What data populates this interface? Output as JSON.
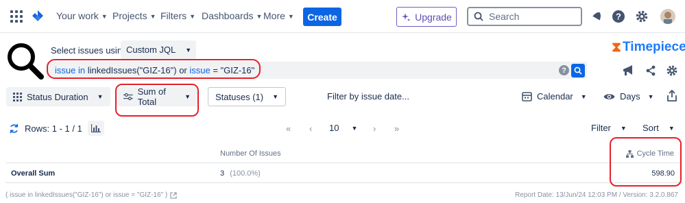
{
  "nav": {
    "items": [
      "Your work",
      "Projects",
      "Filters",
      "Dashboards",
      "More"
    ],
    "create_label": "Create",
    "upgrade_label": "Upgrade",
    "search_placeholder": "Search"
  },
  "filter": {
    "select_label": "Select issues using",
    "mode": "Custom JQL",
    "jql": {
      "kw1": "issue",
      "op1": " in ",
      "rest1": "linkedIssues(\"GIZ-16\") or ",
      "kw2": "issue",
      "rest2": " = \"GIZ-16\""
    },
    "help_label": "?"
  },
  "brand": {
    "name": "Timepiece"
  },
  "toolbar": {
    "status_duration": "Status Duration",
    "sum_of_total": "Sum of Total",
    "statuses": "Statuses (1)",
    "filter_by_date": "Filter by issue date...",
    "calendar": "Calendar",
    "days": "Days"
  },
  "pager": {
    "rows_text": "Rows: 1 - 1 / 1",
    "first": "«",
    "prev": "‹",
    "page_size": "10",
    "next": "›",
    "last": "»",
    "filter_label": "Filter",
    "sort_label": "Sort"
  },
  "table": {
    "columns": [
      "Number Of Issues",
      "Cycle Time"
    ],
    "rows": [
      {
        "label": "Overall Sum",
        "count": "3",
        "percent": "(100.0%)",
        "cycle_time": "598.90"
      }
    ]
  },
  "footer": {
    "query": "( issue in linkedIssues(\"GIZ-16\") or issue = \"GIZ-16\" )",
    "report": "Report Date: 13/Jun/24 12:03 PM / Version: 3.2.0.867"
  },
  "colors": {
    "accent": "#0c66e4",
    "highlight": "#e5202a",
    "upgrade": "#6e5dc6",
    "brand_orange": "#f0661a"
  }
}
